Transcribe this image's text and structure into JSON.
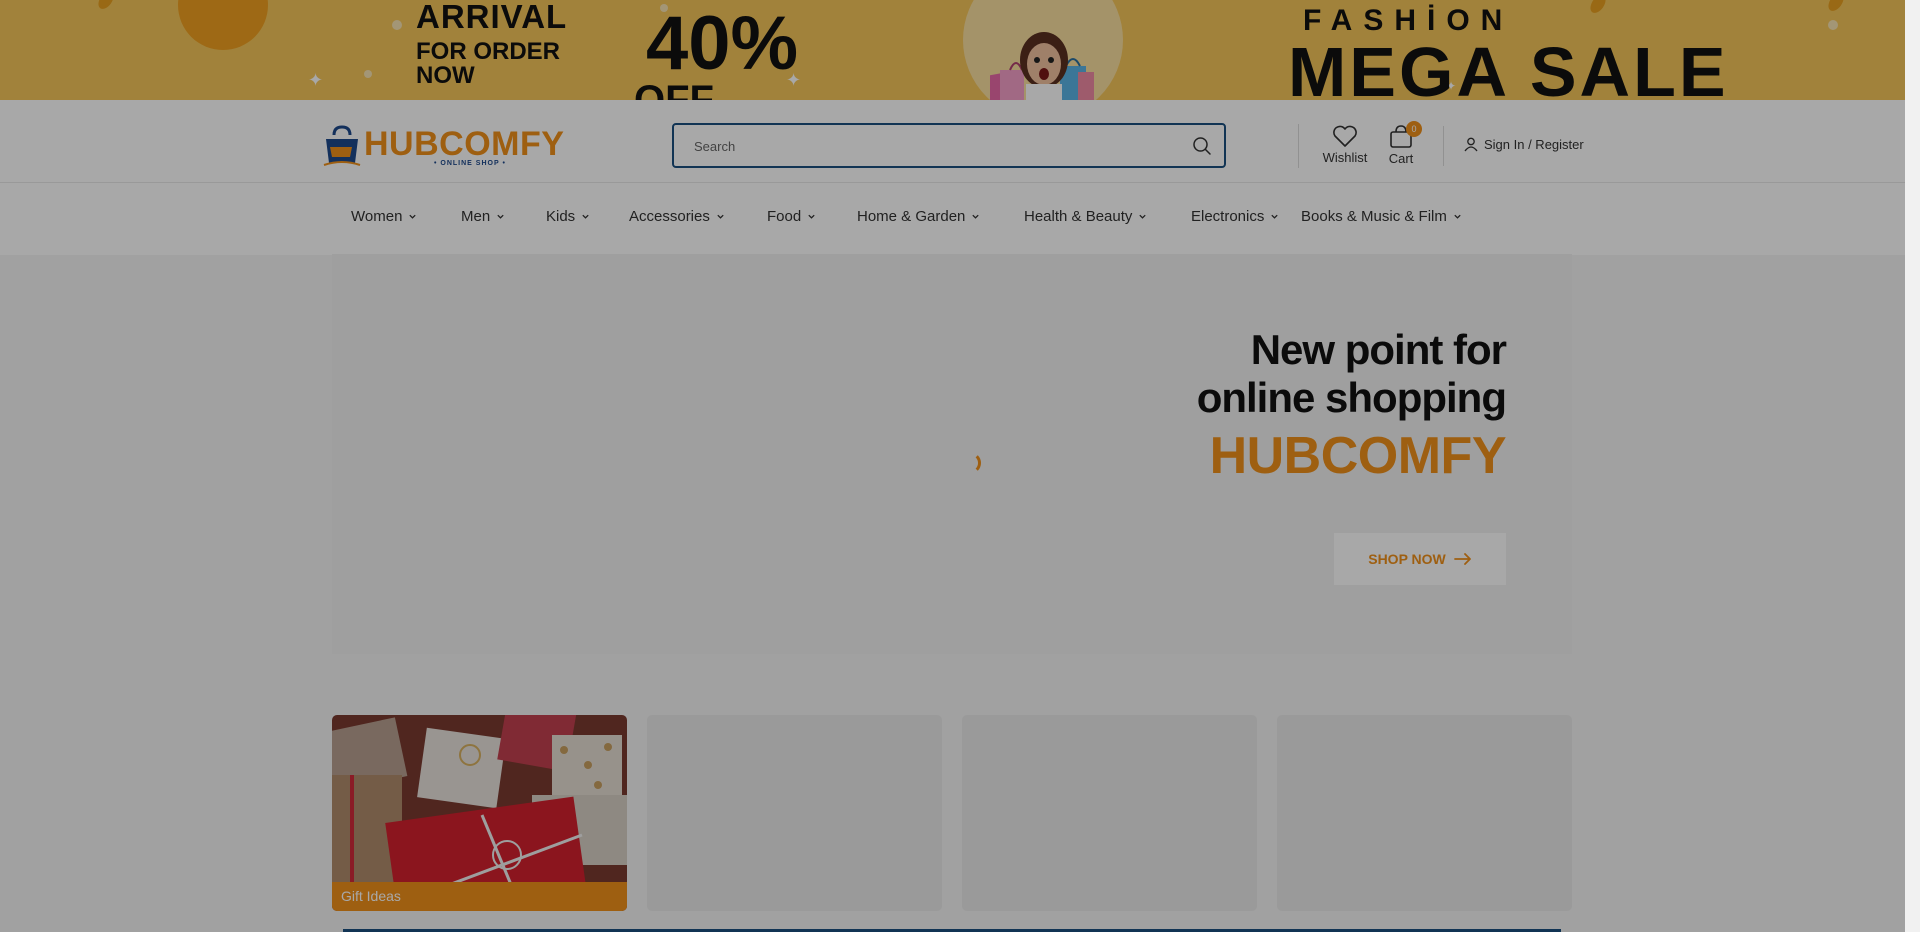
{
  "promo": {
    "arrival": "ARRIVAL",
    "order_line1": "FOR ORDER",
    "order_line2": "NOW",
    "percent": "40%",
    "off": "OFF",
    "fashion": "FASHİON",
    "mega_sale": "MEGA SALE"
  },
  "header": {
    "logo_text": "HUBCOMFY",
    "logo_tagline": "• ONLINE SHOP •",
    "search_placeholder": "Search",
    "wishlist_label": "Wishlist",
    "cart_label": "Cart",
    "cart_count": "0",
    "sign_in_label": "Sign In / Register"
  },
  "nav": {
    "items": [
      {
        "label": "Women"
      },
      {
        "label": "Men"
      },
      {
        "label": "Kids"
      },
      {
        "label": "Accessories"
      },
      {
        "label": "Food"
      },
      {
        "label": "Home & Garden"
      },
      {
        "label": "Health & Beauty"
      },
      {
        "label": "Electronics"
      },
      {
        "label": "Books & Music & Film"
      }
    ]
  },
  "hero": {
    "headline_line1": "New point for",
    "headline_line2": "online shopping",
    "brand": "HUBCOMFY",
    "shop_now_label": "SHOP NOW"
  },
  "categories": [
    {
      "label": "Gift Ideas"
    }
  ],
  "colors": {
    "accent": "#f0901a",
    "brand_blue": "#1b4f80",
    "promo_bg": "#f5c65a"
  }
}
